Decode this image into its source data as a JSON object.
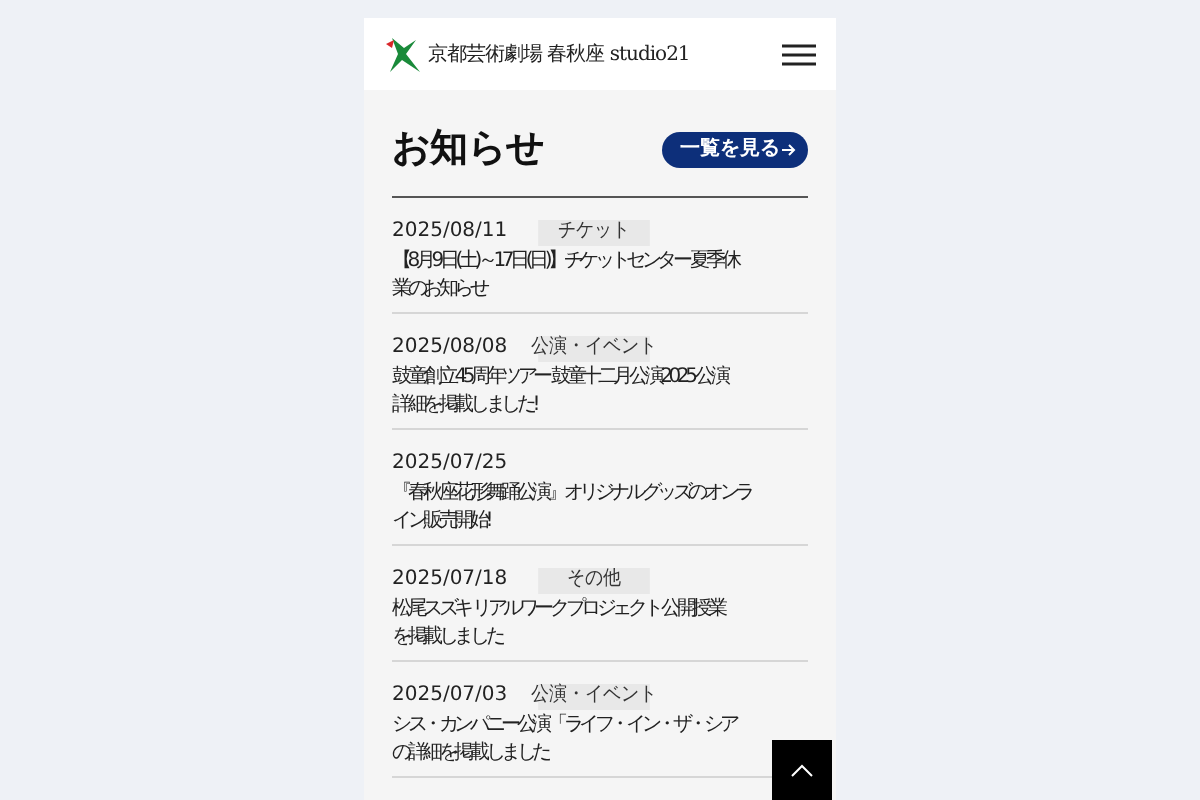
{
  "header": {
    "logo_text": "京都芸術劇場 春秋座 studio21"
  },
  "news": {
    "title": "お知らせ",
    "more_button": "一覧を見る",
    "items": [
      {
        "date": "2025/08/11",
        "tag": "チケット",
        "lines": [
          "【8月9日(土)～17日(日)】チケットセンター 夏季休",
          "業のお知らせ"
        ]
      },
      {
        "date": "2025/08/08",
        "tag": "公演・イベント",
        "lines": [
          "鼓童創立45周年ツアー 鼓童十二月公演2025 公演",
          "詳細を掲載しました!"
        ]
      },
      {
        "date": "2025/07/25",
        "lines": [
          "『春秋座花形舞踊公演』オリジナルグッズのオンラ",
          "イン販売開始!"
        ]
      },
      {
        "date": "2025/07/18",
        "tag": "その他",
        "lines": [
          "松尾スズキ リアルワークプロジェクト 公開授業",
          "を掲載しました"
        ]
      },
      {
        "date": "2025/07/03",
        "tag": "公演・イベント",
        "lines": [
          "シス・カンパニー公演「ライフ・イン・ザ・シア",
          "の詳細を掲載しました"
        ]
      }
    ]
  }
}
